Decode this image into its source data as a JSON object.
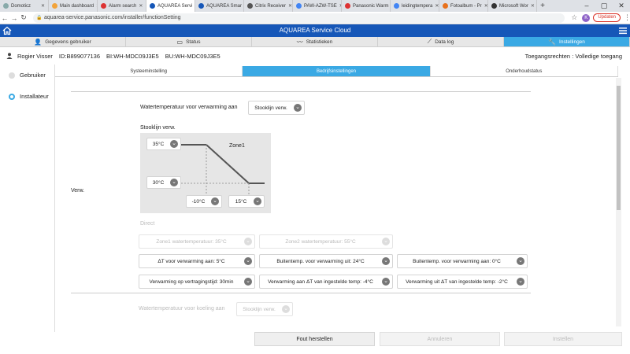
{
  "browser": {
    "tabs": [
      {
        "label": "Domoticz"
      },
      {
        "label": "Main dashboard"
      },
      {
        "label": "Alarm search"
      },
      {
        "label": "AQUAREA Servi"
      },
      {
        "label": "AQUAREA Smar"
      },
      {
        "label": "Citrix Receiver"
      },
      {
        "label": "PAW-AZW-TSE"
      },
      {
        "label": "Panasonic Warm"
      },
      {
        "label": "leidingtempera"
      },
      {
        "label": "Fotoalbum - Pr"
      },
      {
        "label": "Microsoft Wor"
      }
    ],
    "url": "aquarea-service.panasonic.com/installer/functionSetting",
    "profile_initial": "K",
    "update_label": "Updaten"
  },
  "header": {
    "title": "AQUAREA Service Cloud"
  },
  "mainnav": [
    {
      "label": "Gegevens gebruiker",
      "icon": "person-icon"
    },
    {
      "label": "Status",
      "icon": "monitor-icon"
    },
    {
      "label": "Statistieken",
      "icon": "chart-icon"
    },
    {
      "label": "Data log",
      "icon": "graph-icon"
    },
    {
      "label": "Instellingen",
      "icon": "wrench-icon"
    }
  ],
  "userbar": {
    "name": "Rogier Visser",
    "id": "ID:B899077136",
    "bi": "BI:WH-MDC09J3E5",
    "bu": "BU:WH-MDC09J3E5",
    "rights": "Toegangsrechten : Volledige toegang"
  },
  "sidebar": [
    {
      "label": "Gebruiker",
      "selected": false
    },
    {
      "label": "Installateur",
      "selected": true
    }
  ],
  "subtabs": [
    {
      "label": "Systeeminstelling"
    },
    {
      "label": "Bedrijfsinstellingen"
    },
    {
      "label": "Onderhoudstatus"
    }
  ],
  "heating": {
    "section_label": "Verw.",
    "water_temp_label": "Watertemperatuur voor verwarming aan",
    "water_temp_value": "Stooklijn verw.",
    "curve_title": "Stooklijn verw.",
    "curve": {
      "high_water": "35°C",
      "low_water": "30°C",
      "low_outdoor": "-10°C",
      "high_outdoor": "15°C",
      "zone_label": "Zone1"
    },
    "direct_label": "Direct",
    "zone1_temp": "Zone1 watertemperatuur: 35°C",
    "zone2_temp": "Zone2 watertemperatuur: 55°C",
    "delta_t": "ΔT voor verwarming aan: 5°C",
    "outdoor_off": "Buitentemp. voor verwarming uit: 24°C",
    "outdoor_on": "Buitentemp. voor verwarming aan: 0°C",
    "delay": "Verwarming op vertragingstijd: 30min",
    "on_delta": "Verwarming aan ΔT van ingestelde temp: -4°C",
    "off_delta": "Verwarming uit ΔT van ingestelde temp: -2°C"
  },
  "cooling": {
    "water_temp_label": "Watertemperatuur voor koeling aan",
    "water_temp_value": "Stooklijn verw."
  },
  "buttons": {
    "reset": "Fout herstellen",
    "cancel": "Annuleren",
    "apply": "Instellen"
  },
  "colors": {
    "header_blue": "#1657b8",
    "active_tab": "#3aa9e4"
  }
}
